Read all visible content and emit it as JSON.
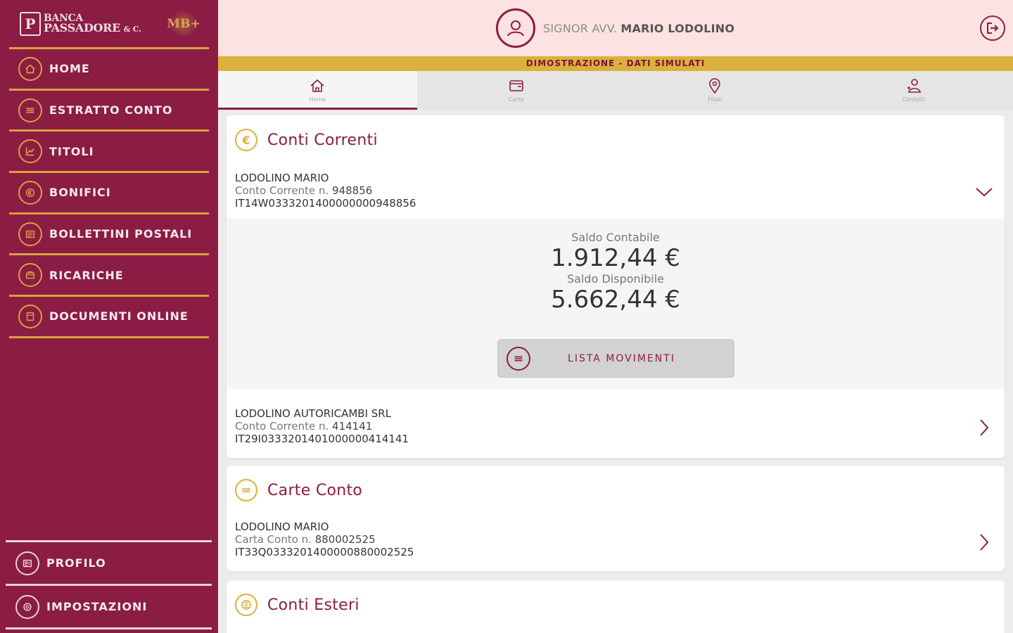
{
  "brand": {
    "line1": "BANCA",
    "line2": "PASSADORE",
    "suffix": "& C.",
    "badge": "MB+"
  },
  "sidebar": {
    "items": [
      {
        "label": "HOME",
        "icon": "home-icon"
      },
      {
        "label": "ESTRATTO CONTO",
        "icon": "list-icon"
      },
      {
        "label": "TITOLI",
        "icon": "chart-icon"
      },
      {
        "label": "BONIFICI",
        "icon": "euro-transfer-icon"
      },
      {
        "label": "BOLLETTINI POSTALI",
        "icon": "bulletin-icon"
      },
      {
        "label": "RICARICHE",
        "icon": "recharge-icon"
      },
      {
        "label": "DOCUMENTI ONLINE",
        "icon": "document-icon"
      }
    ],
    "bottom": [
      {
        "label": "PROFILO",
        "icon": "profile-icon"
      },
      {
        "label": "IMPOSTAZIONI",
        "icon": "settings-icon"
      }
    ]
  },
  "header": {
    "user_prefix": "SIGNOR AVV.",
    "user_name": "MARIO LODOLINO",
    "demo_banner": "DIMOSTRAZIONE - DATI SIMULATI"
  },
  "tabs": [
    {
      "label": "Home",
      "icon": "home-icon",
      "active": true
    },
    {
      "label": "Carte",
      "icon": "card-icon",
      "active": false
    },
    {
      "label": "Filiali",
      "icon": "map-pin-icon",
      "active": false
    },
    {
      "label": "Contatti",
      "icon": "contacts-icon",
      "active": false
    }
  ],
  "conti_correnti": {
    "title": "Conti Correnti",
    "accounts": [
      {
        "name": "LODOLINO MARIO",
        "type_label": "Conto Corrente n.",
        "number": "948856",
        "iban": "IT14W0333201400000000948856",
        "expanded": true,
        "saldo_contabile_label": "Saldo Contabile",
        "saldo_contabile": "1.912,44 €",
        "saldo_disponibile_label": "Saldo Disponibile",
        "saldo_disponibile": "5.662,44 €",
        "movements_button": "LISTA MOVIMENTI"
      },
      {
        "name": "LODOLINO AUTORICAMBI SRL",
        "type_label": "Conto Corrente n.",
        "number": "414141",
        "iban": "IT29I0333201401000000414141",
        "expanded": false
      }
    ]
  },
  "carte_conto": {
    "title": "Carte Conto",
    "accounts": [
      {
        "name": "LODOLINO MARIO",
        "type_label": "Carta Conto n.",
        "number": "880002525",
        "iban": "IT33Q0333201400000880002525"
      }
    ]
  },
  "conti_esteri": {
    "title": "Conti Esteri"
  },
  "colors": {
    "primary": "#8b1c44",
    "accent": "#dbb13d",
    "header_bg": "#fde2e2"
  }
}
